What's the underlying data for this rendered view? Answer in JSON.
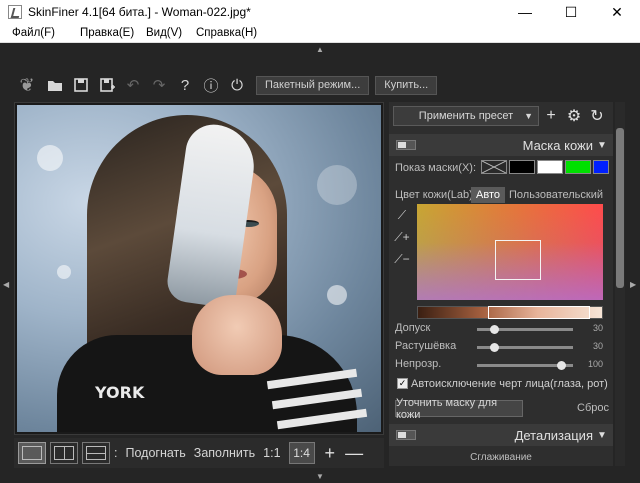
{
  "window": {
    "title": "SkinFiner 4.1[64 бита.] - Woman-022.jpg*",
    "minimize": "—",
    "maximize": "☐",
    "close": "✕"
  },
  "menu": [
    "Файл(F)",
    "Правка(E)",
    "Вид(V)",
    "Справка(H)"
  ],
  "toolbar": {
    "icons": [
      "feather-icon",
      "open-folder-icon",
      "save-icon",
      "save-as-icon",
      "undo-icon",
      "redo-icon",
      "help-icon",
      "info-icon",
      "plugin-icon"
    ],
    "batch_label": "Пакетный режим...",
    "buy_label": "Купить..."
  },
  "image": {
    "shirt_text": "YORK"
  },
  "viewbar": {
    "hidden_label": ":",
    "fit_label": "Подогнать",
    "fill_label": "Заполнить",
    "one_to_one": "1:1",
    "zoom_value": "1:4",
    "zoom_in": "+",
    "zoom_out": "—"
  },
  "panel": {
    "preset_label": "Применить пресет",
    "skin_mask": {
      "title": "Маска кожи",
      "show_mask_label": "Показ маски(X):",
      "mask_swatches": [
        "#000000",
        "#ffffff",
        "#00e000",
        "#0020ff"
      ],
      "skin_color_label": "Цвет кожи(Lab):",
      "auto_label": "Авто",
      "custom_label": "Пользовательский",
      "sliders": [
        {
          "label": "Допуск",
          "value": "30",
          "fraction": 0.18
        },
        {
          "label": "Растушёвка",
          "value": "30",
          "fraction": 0.18
        },
        {
          "label": "Непрозр.",
          "value": "100",
          "fraction": 0.88
        }
      ],
      "auto_exclude_label": "Автоисключение черт лица(глаза, рот)",
      "auto_exclude_checked": true,
      "refine_label": "Уточнить маску для кожи",
      "reset_label": "Сброс"
    },
    "detail": {
      "title": "Детализация",
      "smoothing_label": "Сглаживание"
    }
  }
}
